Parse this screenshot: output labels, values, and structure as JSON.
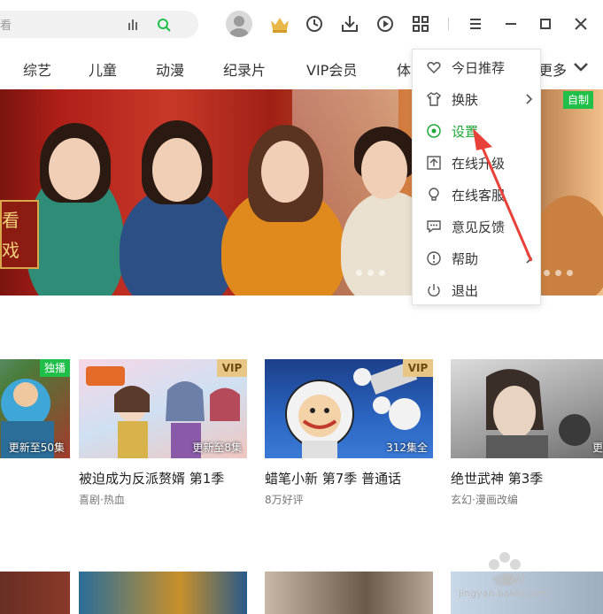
{
  "search": {
    "placeholder": "看"
  },
  "nav": {
    "items": [
      "综艺",
      "儿童",
      "动漫",
      "纪录片",
      "VIP会员",
      "体",
      "更多"
    ]
  },
  "banner": {
    "badge": "自制",
    "sign_text": "看戏"
  },
  "menu": {
    "items": [
      {
        "label": "今日推荐",
        "icon": "heart-icon",
        "submenu": false
      },
      {
        "label": "换肤",
        "icon": "shirt-icon",
        "submenu": true
      },
      {
        "label": "设置",
        "icon": "settings-icon",
        "submenu": false,
        "active": true
      },
      {
        "label": "在线升级",
        "icon": "upgrade-icon",
        "submenu": false
      },
      {
        "label": "在线客服",
        "icon": "bulb-icon",
        "submenu": false
      },
      {
        "label": "意见反馈",
        "icon": "feedback-icon",
        "submenu": false
      },
      {
        "label": "帮助",
        "icon": "help-icon",
        "submenu": true
      },
      {
        "label": "退出",
        "icon": "power-icon",
        "submenu": false
      }
    ]
  },
  "cards": [
    {
      "title": "",
      "subtitle": "",
      "badge": "独播",
      "episode": "更新至50集"
    },
    {
      "title": "被迫成为反派赘婿 第1季",
      "subtitle": "喜剧·热血",
      "badge": "VIP",
      "episode": "更新至8集"
    },
    {
      "title": "蜡笔小新 第7季 普通话",
      "subtitle": "8万好评",
      "badge": "VIP",
      "episode": "312集全"
    },
    {
      "title": "绝世武神 第3季",
      "subtitle": "玄幻·漫画改编",
      "badge": "",
      "episode": "更新"
    }
  ],
  "watermark": {
    "text": "经验",
    "url": "jingyan.baidu.com"
  },
  "colors": {
    "accent": "#1fa838",
    "vip": "#e7c686",
    "arrow": "#e8413a"
  }
}
